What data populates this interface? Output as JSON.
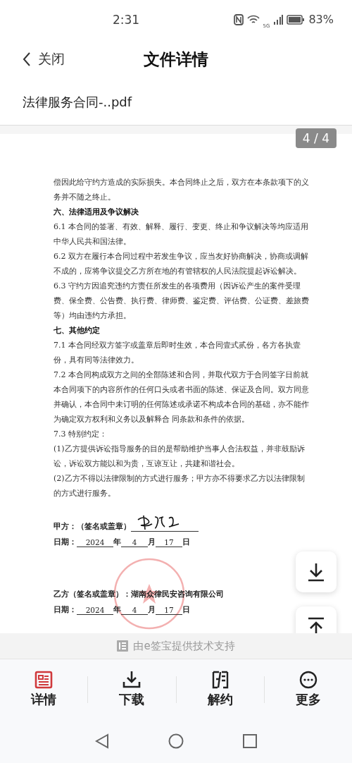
{
  "status_bar": {
    "time": "2:31",
    "network": "5G",
    "battery": "83%"
  },
  "header": {
    "back_label": "关闭",
    "title": "文件详情"
  },
  "file_name": "法律服务合同-..pdf",
  "page_indicator": "4 / 4",
  "document": {
    "paragraphs": [
      {
        "kind": "text",
        "text": "偿因此给守约方造成的实际损失。本合同终止之后，双方在本条款项下的义务并不随之终止。"
      },
      {
        "kind": "heading",
        "text": "六、法律适用及争议解决"
      },
      {
        "kind": "text",
        "text": "6.1  本合同的签署、有效、解释、履行、变更、终止和争议解决等均应适用中华人民共和国法律。"
      },
      {
        "kind": "text",
        "text": "6.2  双方在履行本合同过程中若发生争议，应当友好协商解决，协商或调解不成的，应将争议提交乙方所在地的有管辖权的人民法院提起诉讼解决。"
      },
      {
        "kind": "text",
        "text": "6.3  守约方因追究违约方责任所发生的各项费用（因诉讼产生的案件受理费、保全费、公告费、执行费、律师费、鉴定费、评估费、公证费、差旅费等）均由违约方承担。"
      },
      {
        "kind": "heading",
        "text": "七、其他约定"
      },
      {
        "kind": "text",
        "text": "7.1  本合同经双方签字或盖章后即时生效，本合同壹式贰份，各方各执壹份，具有同等法律效力。"
      },
      {
        "kind": "text",
        "text": "7.2  本合同构成双方之间的全部陈述和合同，并取代双方于合同签字日前就本合同项下的内容所作的任何口头或者书面的陈述、保证及合同。双方同意并确认，本合同中未订明的任何陈述或承诺不构成本合同的基础，亦不能作为确定双方权利和义务以及解释合 同条款和条件的依据。"
      },
      {
        "kind": "text",
        "text": "7.3  特别约定："
      },
      {
        "kind": "text",
        "text": "(1)乙方提供诉讼指导服务的目的是帮助维护当事人合法权益，并非鼓励诉讼，诉讼双方能以和为贵，互谅互让，共建和谐社会。"
      },
      {
        "kind": "text",
        "text": "(2)乙方不得以法律限制的方式进行服务；甲方亦不得要求乙方以法律限制的方式进行服务。"
      }
    ],
    "party_a": {
      "label": "甲方：（签名或盖章）",
      "date_label": "日期：",
      "year": "2024",
      "year_unit": "年",
      "month": "4",
      "month_unit": "月",
      "day": "17",
      "day_unit": "日"
    },
    "party_b": {
      "label": "乙方（签名或盖章）：",
      "value": "湖南众律民安咨询有限公司",
      "date_label": "日期：",
      "year": "2024",
      "year_unit": "年",
      "month": "4",
      "month_unit": "月",
      "day": "17",
      "day_unit": "日"
    }
  },
  "powered_by": "由e签宝提供技术支持",
  "tabs": [
    {
      "label": "详情",
      "selected": true
    },
    {
      "label": "下载",
      "selected": false
    },
    {
      "label": "解约",
      "selected": false
    },
    {
      "label": "更多",
      "selected": false
    }
  ]
}
